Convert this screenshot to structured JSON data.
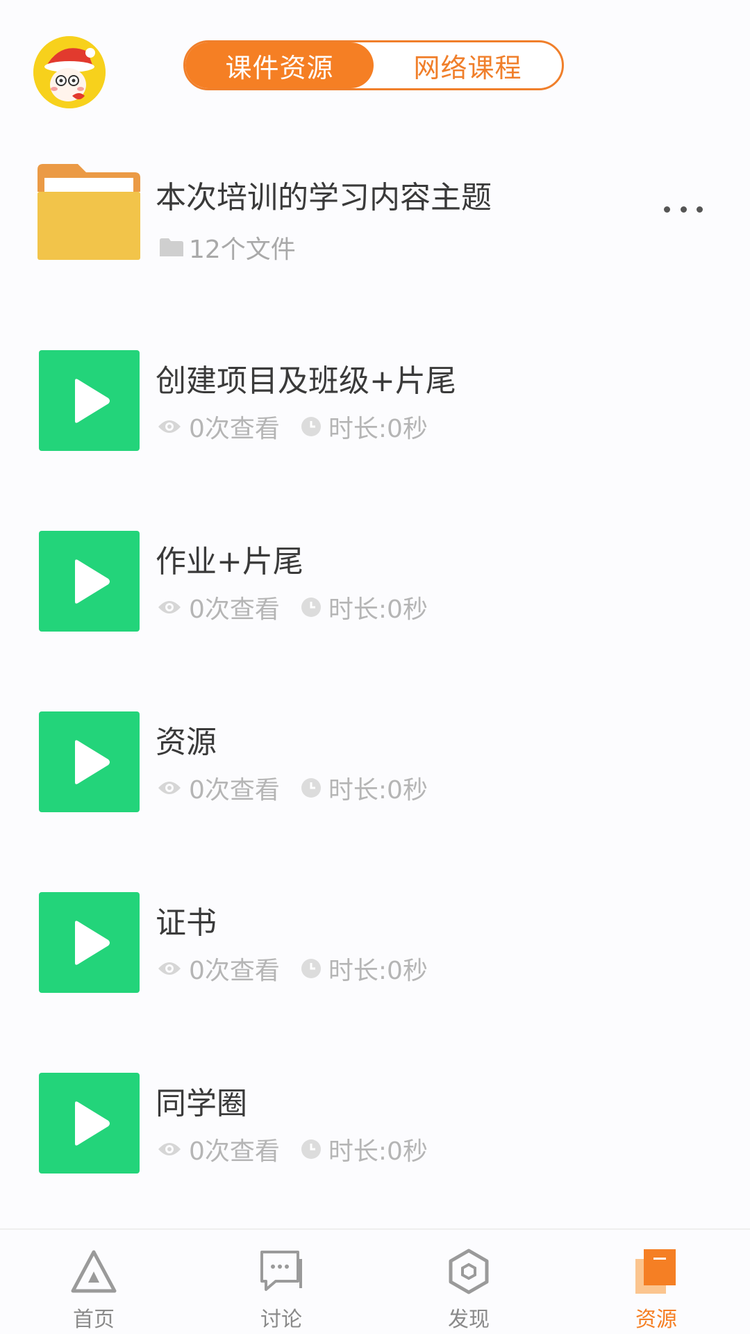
{
  "header": {
    "tabs": [
      {
        "label": "课件资源",
        "active": true
      },
      {
        "label": "网络课程",
        "active": false
      }
    ]
  },
  "folder": {
    "title": "本次培训的学习内容主题",
    "file_count": "12个文件"
  },
  "videos": [
    {
      "title": "创建项目及班级+片尾",
      "views": "0次查看",
      "duration": "时长:0秒"
    },
    {
      "title": "作业+片尾",
      "views": "0次查看",
      "duration": "时长:0秒"
    },
    {
      "title": "资源",
      "views": "0次查看",
      "duration": "时长:0秒"
    },
    {
      "title": "证书",
      "views": "0次查看",
      "duration": "时长:0秒"
    },
    {
      "title": "同学圈",
      "views": "0次查看",
      "duration": "时长:0秒"
    }
  ],
  "bottom_nav": {
    "items": [
      {
        "label": "首页",
        "icon": "triangle-home-icon"
      },
      {
        "label": "讨论",
        "icon": "chat-icon"
      },
      {
        "label": "发现",
        "icon": "hexagon-discover-icon"
      },
      {
        "label": "资源",
        "icon": "resource-book-icon"
      }
    ],
    "active_index": 3
  },
  "colors": {
    "accent": "#f57f24",
    "video_tile": "#23d47a",
    "folder": "#f2c44a"
  }
}
